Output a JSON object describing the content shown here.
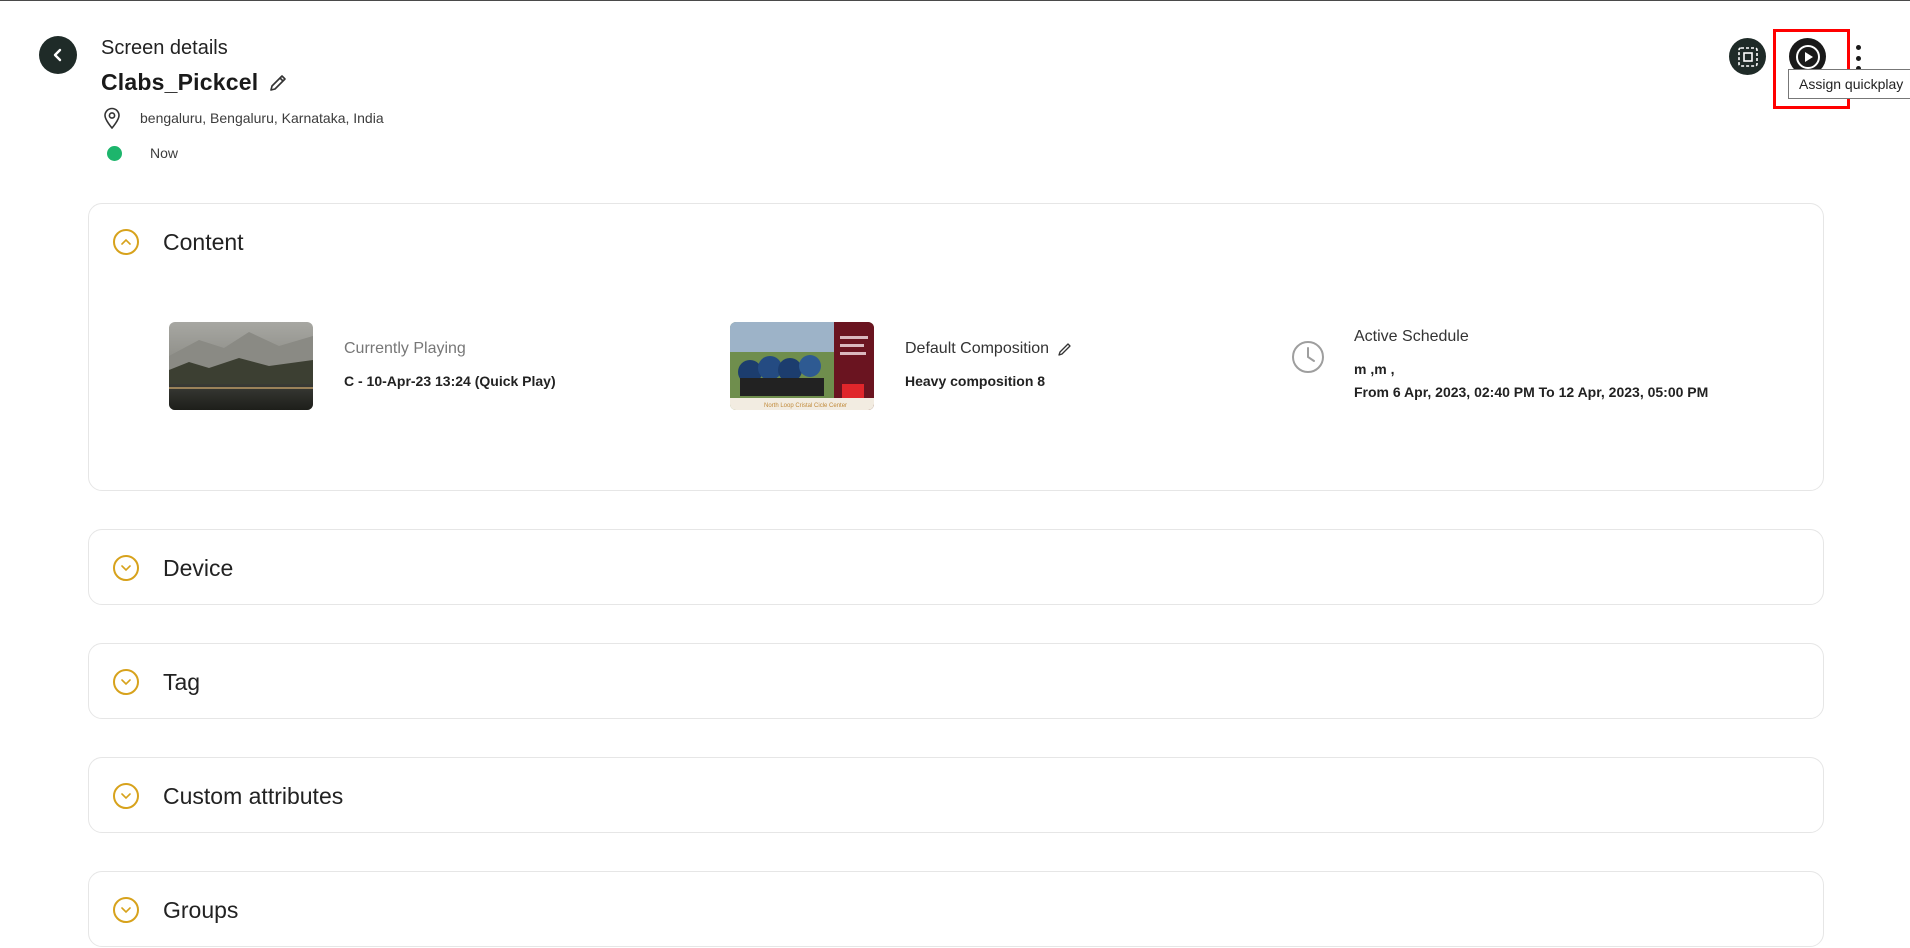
{
  "header": {
    "eyebrow": "Screen details",
    "title": "Clabs_Pickcel",
    "location": "bengaluru, Bengaluru, Karnataka, India",
    "status": "Now"
  },
  "actions": {
    "tooltip": "Assign quickplay"
  },
  "sections": {
    "content": "Content",
    "device": "Device",
    "tag": "Tag",
    "custom": "Custom attributes",
    "groups": "Groups"
  },
  "content": {
    "playing_label": "Currently Playing",
    "playing_value": "C - 10-Apr-23 13:24   (Quick Play)",
    "composition_label": "Default Composition",
    "composition_value": "Heavy composition   8",
    "schedule_label": "Active Schedule",
    "schedule_line1": "m ,m ,",
    "schedule_line2": "From 6 Apr, 2023, 02:40 PM To 12 Apr, 2023, 05:00 PM",
    "thumb_caption": "North Loop Cristal Cicle Center"
  },
  "colors": {
    "accent": "#d7a21c",
    "status_green": "#1db56c",
    "dark": "#1f2b28",
    "highlight": "#ff0000"
  }
}
